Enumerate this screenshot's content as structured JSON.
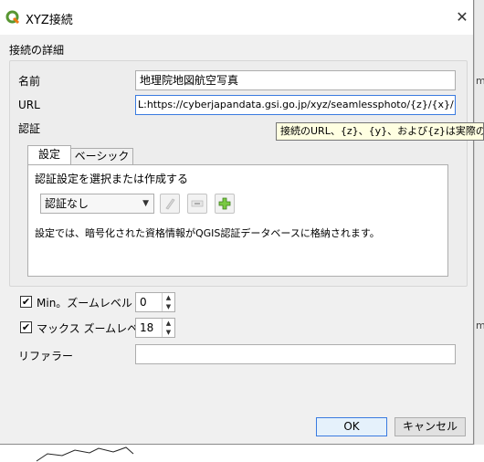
{
  "window": {
    "title": "XYZ接続",
    "close_glyph": "✕",
    "brand_color": "#589632"
  },
  "connection_details": {
    "section_label": "接続の詳細",
    "name_label": "名前",
    "name_value": "地理院地図航空写真",
    "url_label": "URL",
    "url_value": "L:https://cyberjapandata.gsi.go.jp/xyz/seamlessphoto/{z}/{x}/{y}.jpg",
    "tooltip": "接続のURL、{z}、{y}、および{z}は実際の値に置"
  },
  "auth": {
    "label": "認証",
    "tabs": [
      {
        "label": "設定"
      },
      {
        "label": "ベーシック"
      }
    ],
    "instruction": "認証設定を選択または作成する",
    "selected_config": "認証なし",
    "note": "設定では、暗号化された資格情報がQGIS認証データベースに格納されます。"
  },
  "zoom": {
    "min_label": "Min。ズームレベル",
    "min_value": "0",
    "min_checked": true,
    "max_label": "マックス ズームレベル",
    "max_value": "18",
    "max_checked": true
  },
  "referer": {
    "label": "リファラー",
    "value": ""
  },
  "buttons": {
    "ok": "OK",
    "cancel": "キャンセル"
  }
}
